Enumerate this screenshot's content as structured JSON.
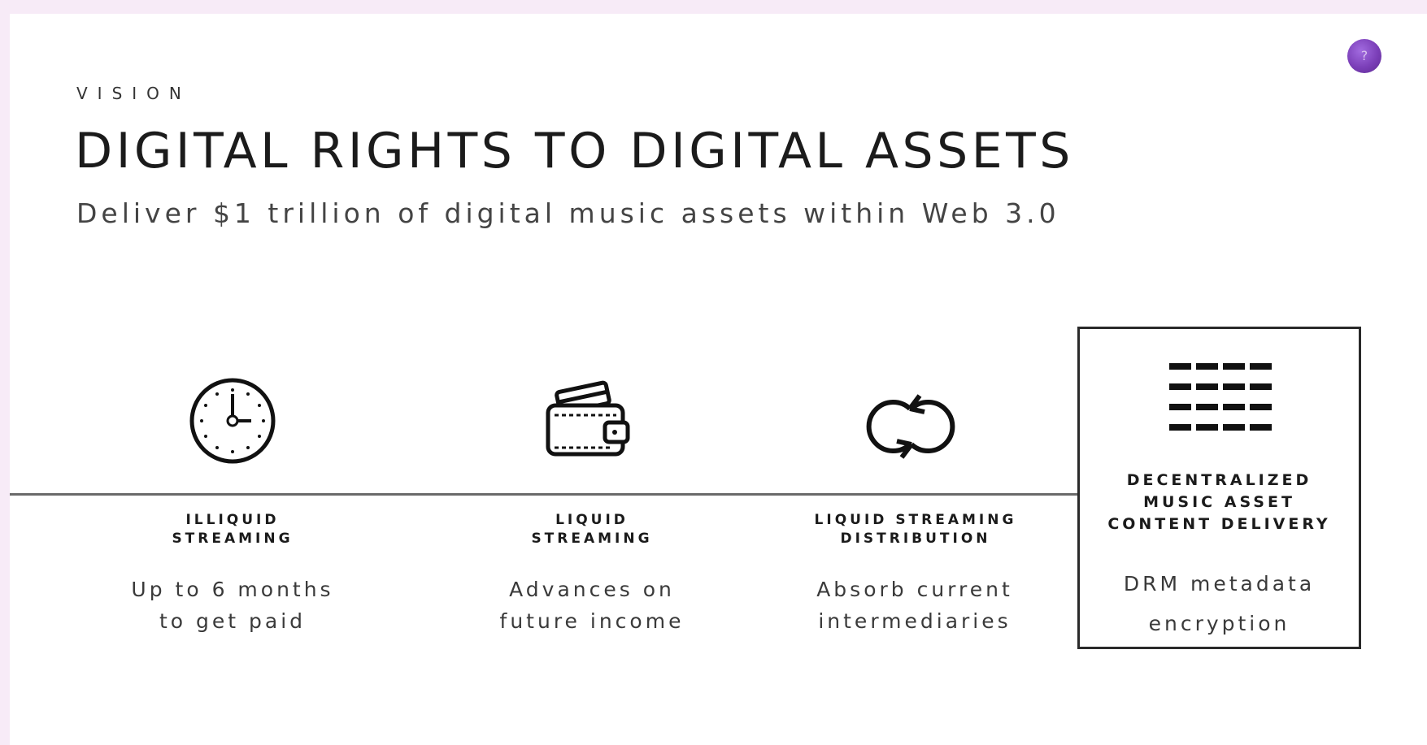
{
  "slide": {
    "eyebrow": "VISION",
    "title": "DIGITAL RIGHTS TO DIGITAL ASSETS",
    "subtitle": "Deliver $1 trillion of digital music assets within Web 3.0",
    "help_badge": "?"
  },
  "steps": [
    {
      "icon": "clock-icon",
      "title": "ILLIQUID\nSTREAMING",
      "description": "Up to 6 months\nto get paid"
    },
    {
      "icon": "wallet-icon",
      "title": "LIQUID\nSTREAMING",
      "description": "Advances on\nfuture income"
    },
    {
      "icon": "loop-arrows-icon",
      "title": "LIQUID STREAMING\nDISTRIBUTION",
      "description": "Absorb current\nintermediaries"
    },
    {
      "icon": "grid-bars-icon",
      "title": "DECENTRALIZED\nMUSIC ASSET\nCONTENT DELIVERY",
      "description": "DRM metadata\nencryption",
      "highlighted": true
    }
  ],
  "colors": {
    "page_background": "#f7ebf7",
    "text": "#1b1b1b",
    "badge": "#7b3fb8"
  }
}
